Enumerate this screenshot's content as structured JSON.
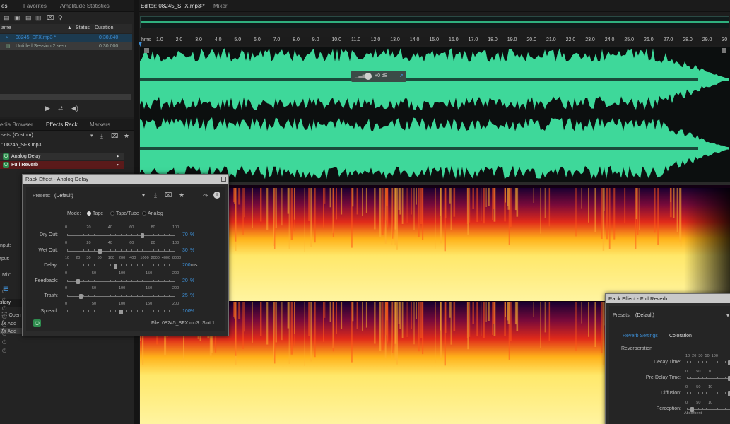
{
  "left_panel": {
    "tabs": [
      "es",
      "Favorites",
      "Amplitude Statistics"
    ],
    "columns": [
      "ame",
      "Status",
      "Duration"
    ],
    "files": [
      {
        "name": "08245_SFX.mp3 *",
        "duration": "0:30.040",
        "selected": true
      },
      {
        "name": "Untitled Session 2.sesx",
        "duration": "0:30.000",
        "selected": false
      }
    ]
  },
  "effects_panel": {
    "tabs": [
      "edia Browser",
      "Effects Rack",
      "Markers"
    ],
    "presets_label": "sets:",
    "presets_value": "(Custom)",
    "file_label": ": 08245_SFX.mp3",
    "effects": [
      "Analog Delay",
      "Full Reverb"
    ],
    "partial_labels": [
      "nput:",
      "tput:",
      "Mix:"
    ],
    "history_title": "story",
    "history_items": [
      "Open",
      "Add",
      "Add"
    ]
  },
  "editor": {
    "tab": "Editor: 08245_SFX.mp3 *",
    "mixer_tab": "Mixer",
    "ruler_unit": "hms",
    "ruler_labels": [
      "1.0",
      "2.0",
      "3.0",
      "4.0",
      "5.0",
      "6.0",
      "7.0",
      "8.0",
      "9.0",
      "10.0",
      "11.0",
      "12.0",
      "13.0",
      "14.0",
      "15.0",
      "16.0",
      "17.0",
      "18.0",
      "19.0",
      "20.0",
      "21.0",
      "22.0",
      "23.0",
      "24.0",
      "25.0",
      "26.0",
      "27.0",
      "28.0",
      "29.0",
      "30"
    ],
    "hud_value": "+0 dB",
    "waveform_color": "#3ed89a"
  },
  "analog_delay": {
    "title": "Rack Effect - Analog Delay",
    "presets_label": "Presets:",
    "presets_value": "(Default)",
    "mode_label": "Mode:",
    "modes": [
      "Tape",
      "Tape/Tube",
      "Analog"
    ],
    "selected_mode": "Tape",
    "params": [
      {
        "label": "Dry Out:",
        "value": "70",
        "unit": "%",
        "scale": [
          "0",
          "20",
          "40",
          "60",
          "80",
          "100"
        ],
        "level": 0.7
      },
      {
        "label": "Wet Out:",
        "value": "30",
        "unit": "%",
        "scale": [
          "0",
          "20",
          "40",
          "60",
          "80",
          "100"
        ],
        "level": 0.3
      },
      {
        "label": "Delay:",
        "value": "200",
        "unit": "ms",
        "scale": [
          "10",
          "20",
          "30",
          "50",
          "100",
          "200",
          "400",
          "1000",
          "2000",
          "4000",
          "8000"
        ],
        "level": 0.45
      },
      {
        "label": "Feedback:",
        "value": "20",
        "unit": "%",
        "scale": [
          "0",
          "50",
          "100",
          "150",
          "200"
        ],
        "level": 0.1
      },
      {
        "label": "Trash:",
        "value": "25",
        "unit": "%",
        "scale": [
          "0",
          "50",
          "100",
          "150",
          "200"
        ],
        "level": 0.125
      },
      {
        "label": "Spread:",
        "value": "100",
        "unit": "%",
        "scale": [
          "0",
          "50",
          "100",
          "150",
          "200"
        ],
        "level": 0.5
      }
    ],
    "file_info": "File: 08245_SFX.mp3",
    "slot_info": "Slot 1"
  },
  "full_reverb": {
    "title": "Rack Effect - Full Reverb",
    "presets_label": "Presets:",
    "presets_value": "(Default)",
    "tabs": [
      "Reverb Settings",
      "Coloration"
    ],
    "section": "Reverberation",
    "params": [
      {
        "label": "Decay Time:",
        "scale": "10  20  30  50  100"
      },
      {
        "label": "Pre-Delay Time:",
        "scale": "0        50       10"
      },
      {
        "label": "Diffusion:",
        "scale": "0        50       10"
      },
      {
        "label": "Perception:",
        "scale": "0        50       10"
      }
    ],
    "absorbent_label": "Absorbent"
  }
}
